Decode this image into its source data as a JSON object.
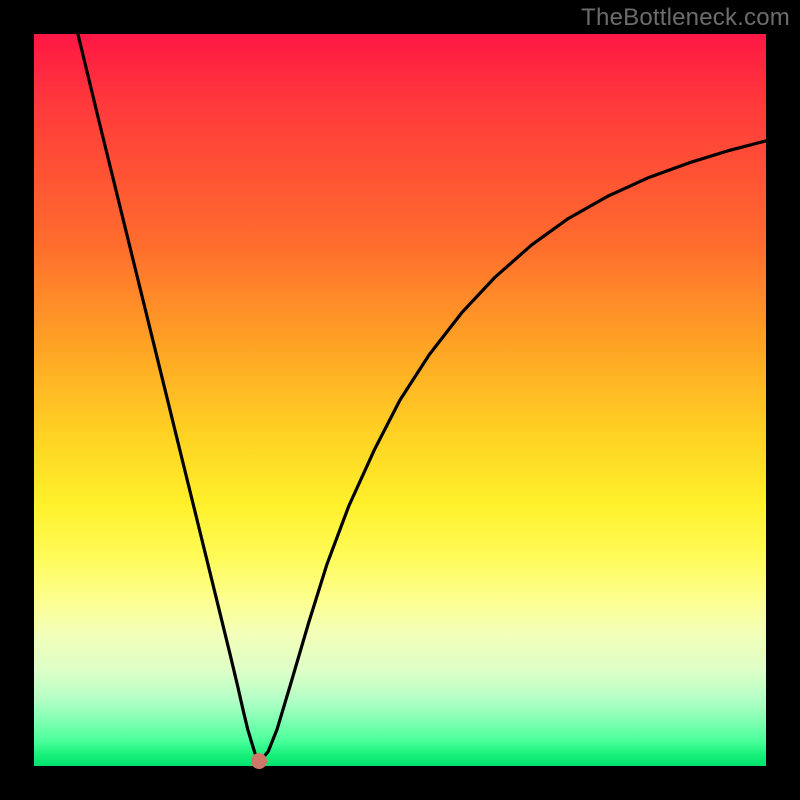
{
  "watermark": "TheBottleneck.com",
  "colors": {
    "frame": "#000000",
    "dot": "#cf7868",
    "curve": "#000000"
  },
  "chart_data": {
    "type": "line",
    "title": "",
    "xlabel": "",
    "ylabel": "",
    "xlim": [
      0,
      1
    ],
    "ylim": [
      0,
      1
    ],
    "grid": false,
    "legend": false,
    "annotations": [],
    "series": [
      {
        "name": "curve",
        "x": [
          0.06,
          0.075,
          0.09,
          0.105,
          0.12,
          0.135,
          0.15,
          0.165,
          0.18,
          0.195,
          0.21,
          0.225,
          0.24,
          0.255,
          0.268,
          0.278,
          0.286,
          0.292,
          0.298,
          0.302,
          0.306,
          0.312,
          0.32,
          0.332,
          0.35,
          0.375,
          0.4,
          0.43,
          0.465,
          0.5,
          0.54,
          0.585,
          0.63,
          0.68,
          0.73,
          0.785,
          0.84,
          0.895,
          0.95,
          1.0
        ],
        "y": [
          1.0,
          0.938,
          0.876,
          0.815,
          0.754,
          0.693,
          0.632,
          0.571,
          0.51,
          0.449,
          0.388,
          0.327,
          0.266,
          0.205,
          0.152,
          0.11,
          0.075,
          0.05,
          0.03,
          0.017,
          0.01,
          0.01,
          0.02,
          0.05,
          0.11,
          0.195,
          0.275,
          0.355,
          0.432,
          0.5,
          0.562,
          0.62,
          0.668,
          0.712,
          0.748,
          0.779,
          0.804,
          0.824,
          0.841,
          0.854
        ]
      }
    ],
    "dot": {
      "x": 0.308,
      "y": 0.007
    }
  }
}
